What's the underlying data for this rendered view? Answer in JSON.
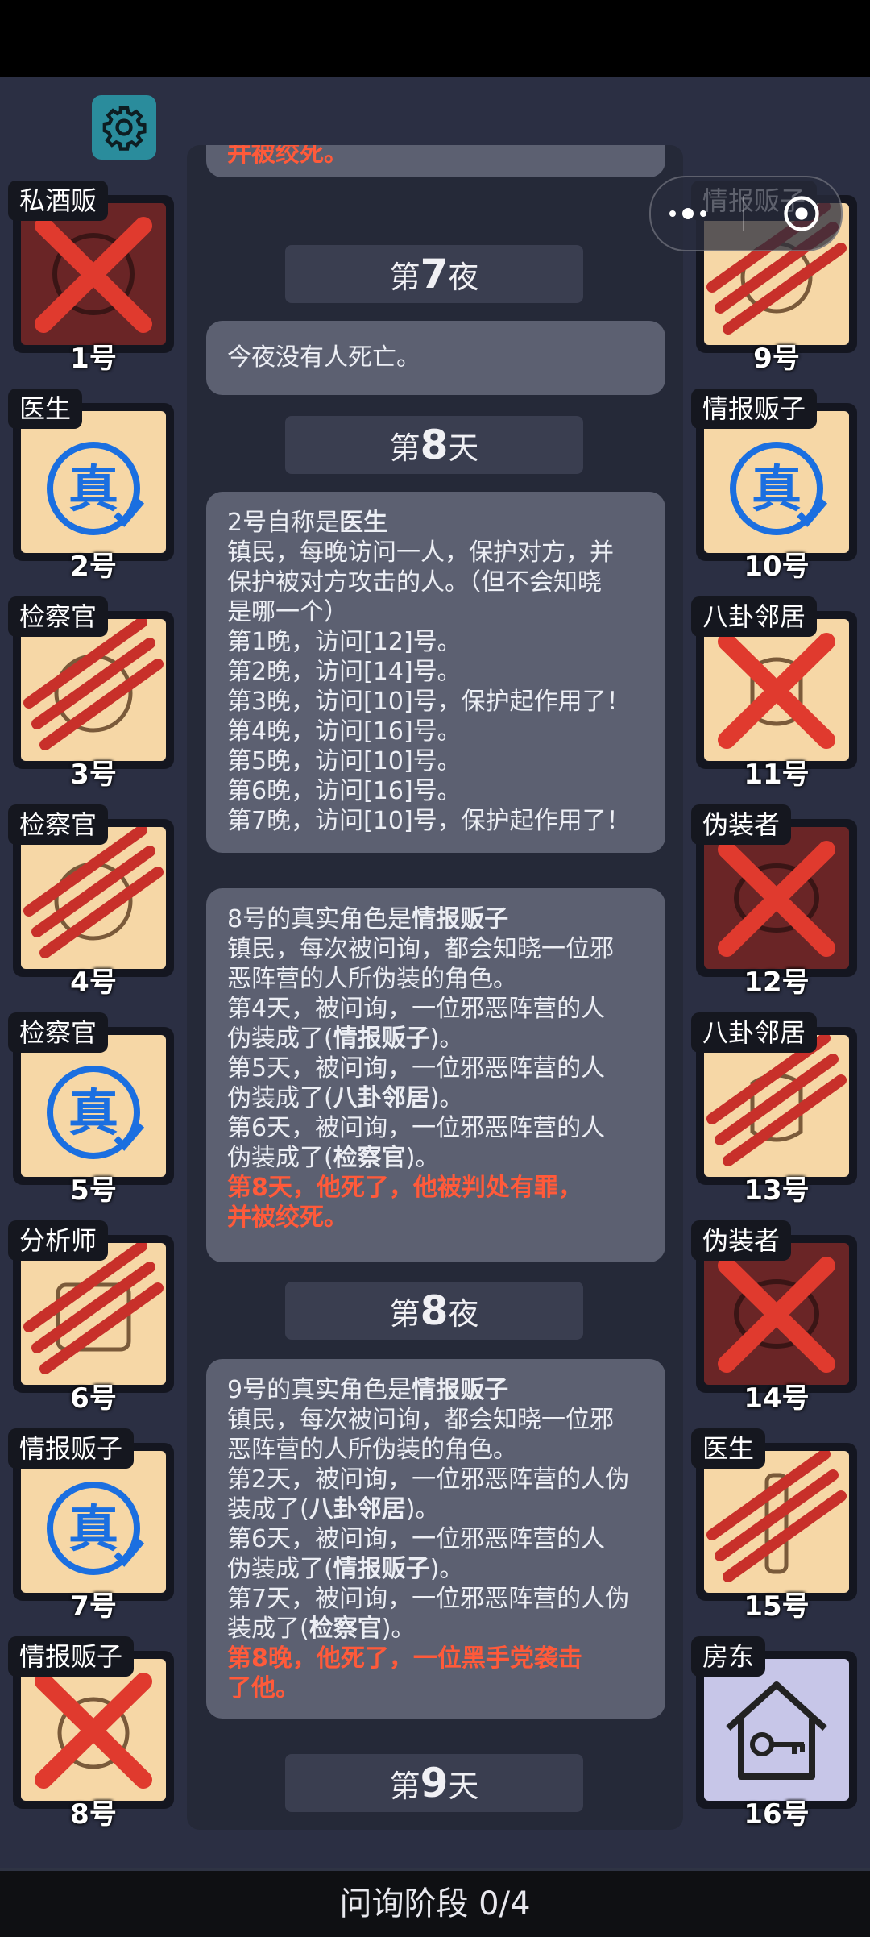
{
  "footer": {
    "phase": "问询阶段 0/4"
  },
  "players": {
    "p1": {
      "role": "私酒贩",
      "num": "1号"
    },
    "p2": {
      "role": "医生",
      "num": "2号"
    },
    "p3": {
      "role": "检察官",
      "num": "3号"
    },
    "p4": {
      "role": "检察官",
      "num": "4号"
    },
    "p5": {
      "role": "检察官",
      "num": "5号"
    },
    "p6": {
      "role": "分析师",
      "num": "6号"
    },
    "p7": {
      "role": "情报贩子",
      "num": "7号"
    },
    "p8": {
      "role": "情报贩子",
      "num": "8号"
    },
    "p9": {
      "role": "情报贩子",
      "num": "9号"
    },
    "p10": {
      "role": "情报贩子",
      "num": "10号"
    },
    "p11": {
      "role": "八卦邻居",
      "num": "11号"
    },
    "p12": {
      "role": "伪装者",
      "num": "12号"
    },
    "p13": {
      "role": "八卦邻居",
      "num": "13号"
    },
    "p14": {
      "role": "伪装者",
      "num": "14号"
    },
    "p15": {
      "role": "医生",
      "num": "15号"
    },
    "p16": {
      "role": "房东",
      "num": "16号"
    }
  },
  "badge": {
    "true_mark": "真"
  },
  "log": {
    "cut_top": "并被绞死。",
    "night7": {
      "pre": "第",
      "n": "7",
      "post": "夜"
    },
    "night7_msg": "今夜没有人死亡。",
    "day8": {
      "pre": "第",
      "n": "8",
      "post": "天"
    },
    "entry2": {
      "claim_pre": "2号自称是",
      "claim_role": "医生",
      "lines": [
        "镇民，每晚访问一人，保护对方，并",
        "保护被对方攻击的人。（但不会知晓",
        "是哪一个）",
        "第1晚，访问[12]号。",
        "第2晚，访问[14]号。",
        "第3晚，访问[10]号，保护起作用了！",
        "第4晚，访问[16]号。",
        "第5晚，访问[10]号。",
        "第6晚，访问[16]号。",
        "第7晚，访问[10]号，保护起作用了！"
      ]
    },
    "entry8": {
      "claim_pre": "8号的真实角色是",
      "claim_role": "情报贩子",
      "l1": "镇民，每次被问询，都会知晓一位邪",
      "l2": "恶阵营的人所伪装的角色。",
      "l3": "第4天，被问询，一位邪恶阵营的人",
      "l4_pre": "伪装成了(",
      "l4_role": "情报贩子",
      "l4_post": ")。",
      "l5": "第5天，被问询，一位邪恶阵营的人",
      "l6_pre": "伪装成了(",
      "l6_role": "八卦邻居",
      "l6_post": ")。",
      "l7": "第6天，被问询，一位邪恶阵营的人",
      "l8_pre": "伪装成了(",
      "l8_role": "检察官",
      "l8_post": ")。",
      "death1": "第8天，他死了，他被判处有罪，",
      "death2": "并被绞死。"
    },
    "night8": {
      "pre": "第",
      "n": "8",
      "post": "夜"
    },
    "entry9": {
      "claim_pre": "9号的真实角色是",
      "claim_role": "情报贩子",
      "l1": "镇民，每次被问询，都会知晓一位邪",
      "l2": "恶阵营的人所伪装的角色。",
      "l3": "第2天，被问询，一位邪恶阵营的人伪",
      "l4_pre": "装成了(",
      "l4_role": "八卦邻居",
      "l4_post": ")。",
      "l5": "第6天，被问询，一位邪恶阵营的人",
      "l6_pre": "伪装成了(",
      "l6_role": "情报贩子",
      "l6_post": ")。",
      "l7": "第7天，被问询，一位邪恶阵营的人伪",
      "l8_pre": "装成了(",
      "l8_role": "检察官",
      "l8_post": ")。",
      "death1": "第8晚，他死了，一位黑手党袭击",
      "death2": "了他。"
    },
    "day9": {
      "pre": "第",
      "n": "9",
      "post": "天"
    }
  }
}
